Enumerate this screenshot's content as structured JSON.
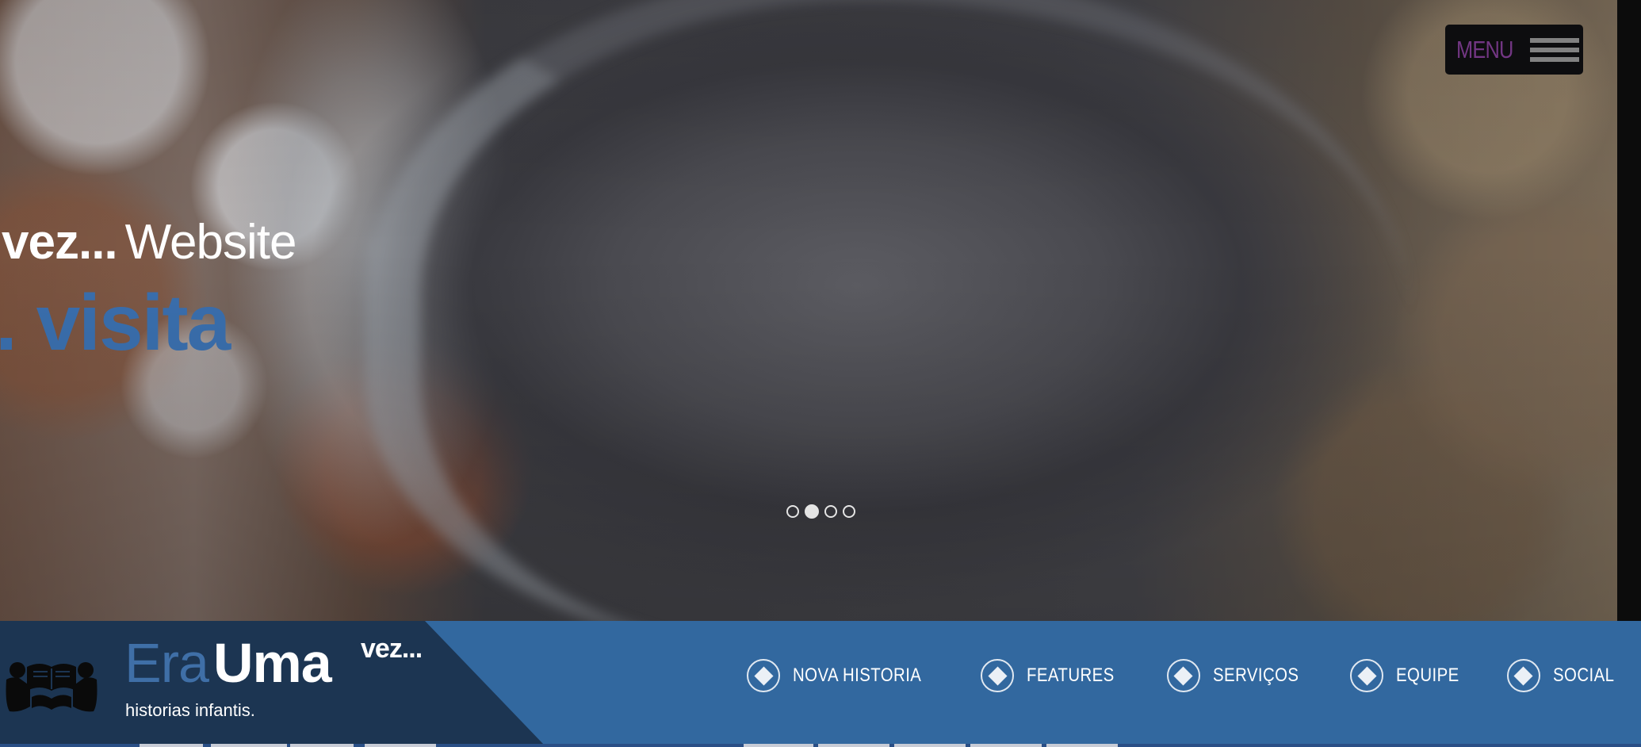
{
  "hero": {
    "headline_bold": "vez...",
    "headline_light": "Website",
    "headline_accent": ". visita",
    "slides": [
      {
        "active": false
      },
      {
        "active": true
      },
      {
        "active": false
      },
      {
        "active": false
      }
    ]
  },
  "menu": {
    "label": "MENU"
  },
  "brand": {
    "era": "Era",
    "uma": "Uma",
    "vez": "vez...",
    "tagline": "historias infantis."
  },
  "nav": {
    "items": [
      {
        "label": "NOVA HISTORIA",
        "icon": "diamond-circle-icon"
      },
      {
        "label": "FEATURES",
        "icon": "diamond-circle-icon"
      },
      {
        "label": "SERVIÇOS",
        "icon": "diamond-circle-icon"
      },
      {
        "label": "EQUIPE",
        "icon": "diamond-circle-icon"
      },
      {
        "label": "SOCIAL",
        "icon": "diamond-circle-icon"
      }
    ]
  },
  "colors": {
    "nav_bar": "#32689f",
    "brand_panel": "#1c3552",
    "accent_blue": "#3a6fae",
    "menu_label": "#7a3a8c"
  }
}
